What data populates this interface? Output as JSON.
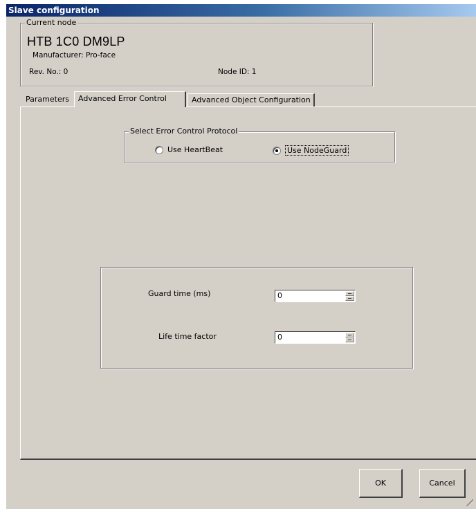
{
  "window": {
    "title": "Slave configuration"
  },
  "current_node": {
    "legend": "Current node",
    "name": "HTB 1C0 DM9LP",
    "manufacturer": "Manufacturer: Pro-face",
    "rev": "Rev. No.: 0",
    "node_id": "Node ID: 1"
  },
  "tabs": [
    {
      "label": "Parameters",
      "active": false
    },
    {
      "label": "Advanced Error Control",
      "active": true
    },
    {
      "label": "Advanced Object Configuration",
      "active": false
    }
  ],
  "error_control": {
    "legend": "Select Error Control Protocol",
    "options": [
      {
        "label": "Use HeartBeat",
        "checked": false
      },
      {
        "label": "Use NodeGuard",
        "checked": true
      }
    ]
  },
  "parameters": {
    "guard_time": {
      "label": "Guard time (ms)",
      "value": "0"
    },
    "life_time_factor": {
      "label": "Life time factor",
      "value": "0"
    }
  },
  "buttons": {
    "ok": "OK",
    "cancel": "Cancel"
  },
  "icons": {
    "resize_grip": "resize-grip-icon"
  }
}
